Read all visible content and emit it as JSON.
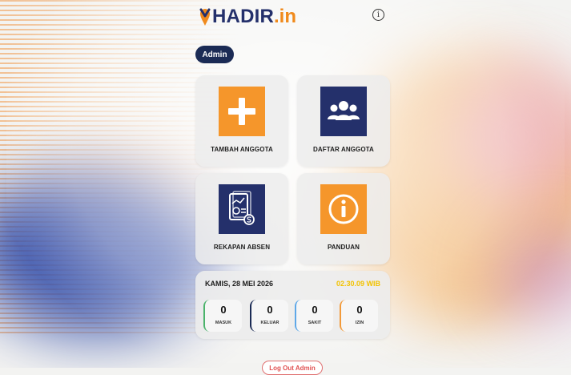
{
  "header": {
    "logo_main": "HADIR",
    "logo_suffix": ".in",
    "info_symbol": "i"
  },
  "user": {
    "role_badge": "Admin"
  },
  "menu": {
    "tiles": [
      {
        "label": "TAMBAH ANGGOTA",
        "icon": "plus-icon",
        "color": "#f5962b"
      },
      {
        "label": "DAFTAR ANGGOTA",
        "icon": "group-icon",
        "color": "#24306b"
      },
      {
        "label": "REKAPAN ABSEN",
        "icon": "report-icon",
        "color": "#24306b"
      },
      {
        "label": "PANDUAN",
        "icon": "info-icon",
        "color": "#f5962b"
      }
    ]
  },
  "summary": {
    "date": "KAMIS, 28 MEI 2026",
    "time": "02.30.09 WIB",
    "stats": [
      {
        "value": "0",
        "label": "MASUK",
        "color": "#4bb36b"
      },
      {
        "value": "0",
        "label": "KELUAR",
        "color": "#1b2b55"
      },
      {
        "value": "0",
        "label": "SAKIT",
        "color": "#5ea8e8"
      },
      {
        "value": "0",
        "label": "IZIN",
        "color": "#f29a3a"
      }
    ]
  },
  "footer": {
    "logout_label": "Log Out Admin"
  }
}
